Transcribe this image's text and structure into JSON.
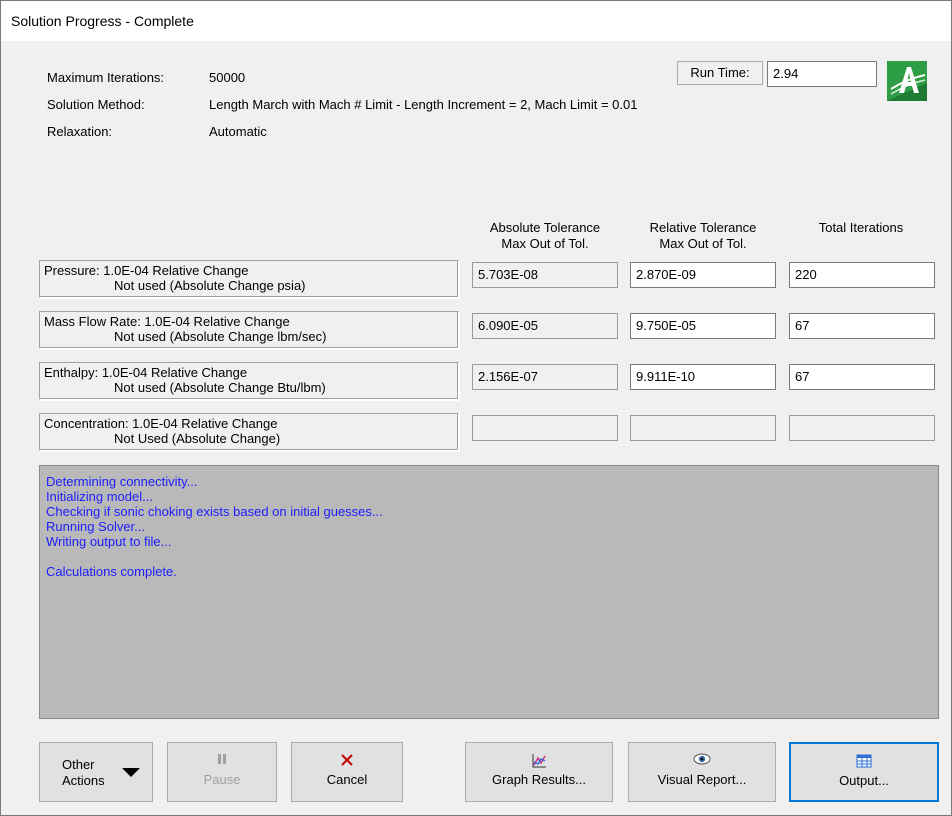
{
  "window": {
    "title": "Solution Progress - Complete"
  },
  "info": {
    "max_iterations_label": "Maximum Iterations:",
    "max_iterations_value": "50000",
    "solution_method_label": "Solution Method:",
    "solution_method_value": "Length March with Mach # Limit - Length Increment = 2, Mach Limit = 0.01",
    "relaxation_label": "Relaxation:",
    "relaxation_value": "Automatic"
  },
  "run_time": {
    "label": "Run Time:",
    "value": "2.94"
  },
  "columns": {
    "abs_tol_line1": "Absolute Tolerance",
    "abs_tol_line2": "Max Out of Tol.",
    "rel_tol_line1": "Relative Tolerance",
    "rel_tol_line2": "Max Out of Tol.",
    "total_iterations": "Total Iterations"
  },
  "rows": [
    {
      "line1": "Pressure: 1.0E-04 Relative Change",
      "line2": "Not used (Absolute Change psia)",
      "abs": "5.703E-08",
      "rel": "2.870E-09",
      "iter": "220"
    },
    {
      "line1": "Mass Flow Rate: 1.0E-04 Relative Change",
      "line2": "Not used (Absolute Change lbm/sec)",
      "abs": "6.090E-05",
      "rel": "9.750E-05",
      "iter": "67"
    },
    {
      "line1": "Enthalpy: 1.0E-04 Relative Change",
      "line2": "Not used (Absolute Change Btu/lbm)",
      "abs": "2.156E-07",
      "rel": "9.911E-10",
      "iter": "67"
    },
    {
      "line1": "Concentration: 1.0E-04 Relative Change",
      "line2": "Not Used (Absolute Change)",
      "abs": "",
      "rel": "",
      "iter": ""
    }
  ],
  "log": [
    "Determining connectivity...",
    "Initializing model...",
    "Checking if sonic choking exists based on initial guesses...",
    "Running Solver...",
    "Writing output to file...",
    "",
    "Calculations complete."
  ],
  "buttons": {
    "other_line1": "Other",
    "other_line2": "Actions",
    "pause": "Pause",
    "cancel": "Cancel",
    "graph": "Graph Results...",
    "visual": "Visual Report...",
    "output": "Output..."
  },
  "colors": {
    "log_text": "#1d1dff",
    "log_background": "#b9b9b9",
    "cancel_icon": "#c00000",
    "logo_green": "#2e9e46",
    "default_button_border": "#0078d7"
  },
  "icons": {
    "logo": "app-logo",
    "pause": "pause-icon",
    "cancel": "cancel-x-icon",
    "graph": "graph-icon",
    "visual": "eye-icon",
    "output": "table-icon",
    "other": "dropdown-caret-icon"
  }
}
